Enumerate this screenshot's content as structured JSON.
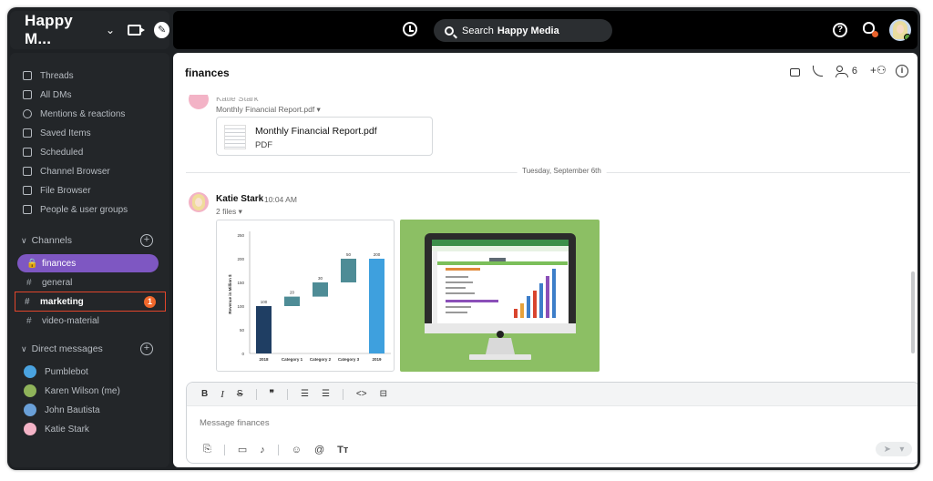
{
  "workspace": {
    "name": "Happy M...",
    "chevron": "⌄"
  },
  "topbar": {
    "search_label": "Search",
    "search_scope": "Happy Media"
  },
  "sidebar": {
    "nav": [
      {
        "label": "Threads",
        "icon": "threads-icon"
      },
      {
        "label": "All DMs",
        "icon": "dms-icon"
      },
      {
        "label": "Mentions & reactions",
        "icon": "mention-icon"
      },
      {
        "label": "Saved Items",
        "icon": "bookmark-icon"
      },
      {
        "label": "Scheduled",
        "icon": "scheduled-icon"
      },
      {
        "label": "Channel Browser",
        "icon": "channel-browser-icon"
      },
      {
        "label": "File Browser",
        "icon": "file-browser-icon"
      },
      {
        "label": "People & user groups",
        "icon": "people-icon"
      }
    ],
    "channels_header": "Channels",
    "channels": [
      {
        "label": "finances",
        "prefix": "🔒",
        "active": true
      },
      {
        "label": "general",
        "prefix": "#"
      },
      {
        "label": "marketing",
        "prefix": "#",
        "unread": "1"
      },
      {
        "label": "video-material",
        "prefix": "#"
      }
    ],
    "dm_header": "Direct messages",
    "dms": [
      {
        "label": "Pumblebot",
        "color": "#4aa3e0"
      },
      {
        "label": "Karen Wilson (me)",
        "color": "#8fb35a"
      },
      {
        "label": "John Bautista",
        "color": "#6aa0d8"
      },
      {
        "label": "Katie Stark",
        "color": "#f3b3c6"
      }
    ]
  },
  "main": {
    "channel_title": "finances",
    "member_count": "6",
    "prev_message": {
      "sender": "Katie Stark",
      "file_label": "Monthly Financial Report.pdf ▾",
      "file_name": "Monthly Financial Report.pdf",
      "file_type": "PDF"
    },
    "date_divider": "Tuesday, September 6th",
    "message": {
      "sender": "Katie Stark",
      "time": "10:04 AM",
      "files_label": "2 files ▾"
    },
    "composer": {
      "placeholder": "Message finances"
    }
  },
  "chart_data": {
    "type": "bar",
    "ylabel": "Revenue in Million $",
    "ylim": [
      0,
      250
    ],
    "yticks": [
      "0",
      "50",
      "100",
      "150",
      "200",
      "250"
    ],
    "categories": [
      "2018",
      "Category 1",
      "Category 2",
      "Category 3",
      "2019"
    ],
    "bars": [
      {
        "base": 0,
        "value": 100,
        "label": "100",
        "color": "#1f3e63"
      },
      {
        "base": 100,
        "value": 20,
        "label": "20",
        "color": "#4e8c96"
      },
      {
        "base": 120,
        "value": 30,
        "label": "30",
        "color": "#4e8c96"
      },
      {
        "base": 150,
        "value": 50,
        "label": "50",
        "color": "#4e8c96"
      },
      {
        "base": 0,
        "value": 200,
        "label": "200",
        "color": "#3ea0de"
      }
    ]
  }
}
